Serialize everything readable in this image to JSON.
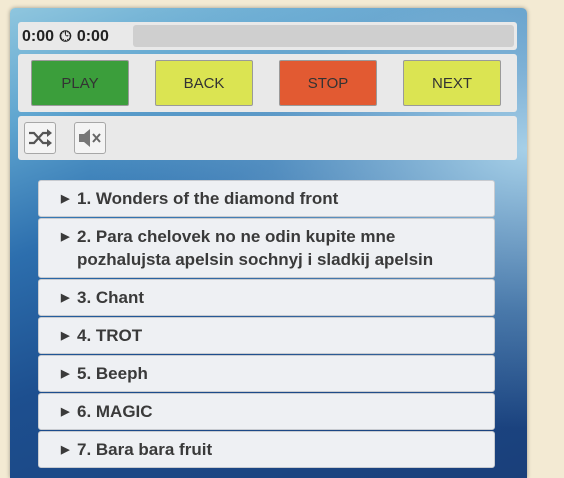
{
  "time": {
    "current": "0:00",
    "total": "0:00",
    "clock_icon": "clock-icon"
  },
  "progress": 0,
  "buttons": {
    "play": "PLAY",
    "back": "BACK",
    "stop": "STOP",
    "next": "NEXT"
  },
  "colors": {
    "play": "#3b9e3b",
    "back": "#dbe452",
    "stop": "#e25a32",
    "next": "#dbe452"
  },
  "tools": {
    "shuffle_icon": "shuffle-icon",
    "mute_icon": "mute-icon"
  },
  "playlist": [
    "1. Wonders of the diamond front",
    "2. Para chelovek no ne odin kupite mne pozhalujsta apelsin sochnyj i sladkij apelsin",
    "3. Chant",
    "4. TROT",
    "5. Beeph",
    "6. MAGIC",
    "7. Bara bara fruit"
  ]
}
